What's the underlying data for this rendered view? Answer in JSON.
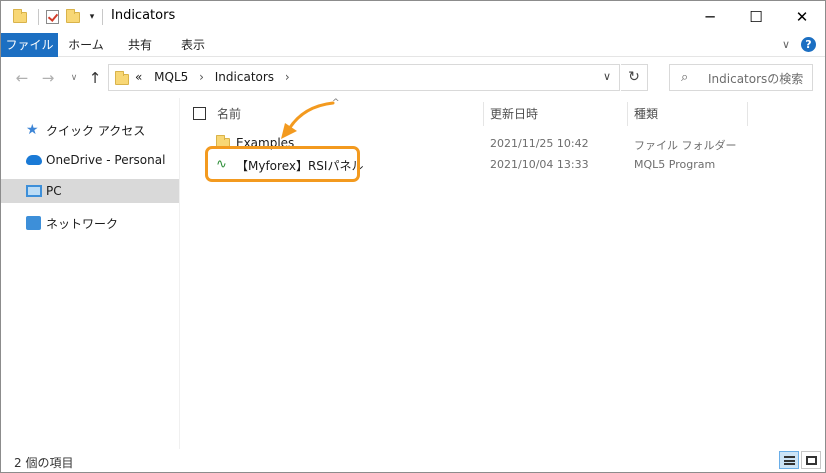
{
  "window": {
    "title": "Indicators",
    "controls": {
      "minimize": "─",
      "maximize": "☐",
      "close": "✕"
    }
  },
  "ribbon": {
    "tabs": [
      {
        "label": "ファイル",
        "active": true
      },
      {
        "label": "ホーム"
      },
      {
        "label": "共有"
      },
      {
        "label": "表示"
      }
    ],
    "expand_glyph": "∨",
    "help_glyph": "?"
  },
  "nav": {
    "back": "←",
    "forward": "→",
    "recent": "∨",
    "up": "↑",
    "address": {
      "overflow": "«",
      "crumbs": [
        "MQL5",
        "Indicators"
      ],
      "separator": "›",
      "dropdown": "∨"
    },
    "refresh": "↻",
    "search": {
      "icon": "search-icon",
      "placeholder": "Indicatorsの検索"
    }
  },
  "sidebar": {
    "items": [
      {
        "label": "クイック アクセス",
        "icon": "star-icon"
      },
      {
        "label": "OneDrive - Personal",
        "icon": "cloud-icon"
      },
      {
        "label": "PC",
        "icon": "pc-icon",
        "selected": true
      },
      {
        "label": "ネットワーク",
        "icon": "network-icon"
      }
    ]
  },
  "columns": {
    "name": "名前",
    "date": "更新日時",
    "type": "種類",
    "sort_glyph": "^"
  },
  "files": [
    {
      "name": "Examples",
      "date": "2021/11/25 10:42",
      "type": "ファイル フォルダー",
      "icon": "folder-icon"
    },
    {
      "name": "【Myforex】RSIパネル",
      "date": "2021/10/04 13:33",
      "type": "MQL5 Program",
      "icon": "mql5-program-icon"
    }
  ],
  "status": {
    "item_count": "2 個の項目"
  },
  "colors": {
    "accent": "#1c6fc2",
    "highlight": "#f39a1f",
    "selected": "#d9d9d9",
    "folder": "#f8d775"
  }
}
